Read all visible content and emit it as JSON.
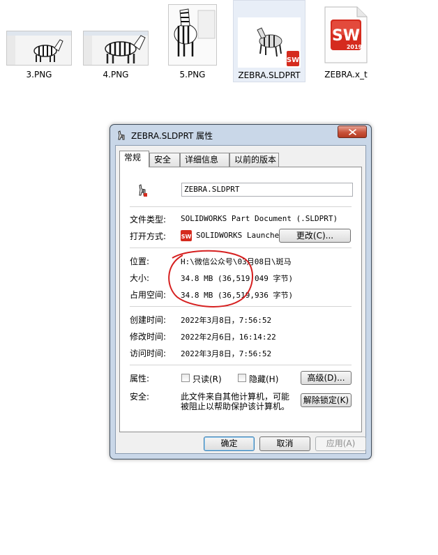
{
  "files": [
    {
      "name": "3.PNG",
      "icon": "zebra-screenshot-thumbnail"
    },
    {
      "name": "4.PNG",
      "icon": "zebra-screenshot-thumbnail"
    },
    {
      "name": "5.PNG",
      "icon": "zebra-screenshot-thumbnail"
    },
    {
      "name": "ZEBRA.SLDPRT",
      "icon": "zebra-part-thumbnail",
      "badge": "SW"
    },
    {
      "name": "ZEBRA.x_t",
      "icon": "solidworks-file-icon",
      "badge": "SW",
      "year": "2019"
    }
  ],
  "dialog": {
    "title": "ZEBRA.SLDPRT 属性",
    "tabs": [
      "常规",
      "安全",
      "详细信息",
      "以前的版本"
    ],
    "active_tab": "常规",
    "filename": "ZEBRA.SLDPRT",
    "file_type_label": "文件类型:",
    "file_type_value": "SOLIDWORKS Part Document (.SLDPRT)",
    "opens_with_label": "打开方式:",
    "opens_with_value": "SOLIDWORKS Launcher",
    "change_button": "更改(C)...",
    "location_label": "位置:",
    "location_value": "H:\\微信公众号\\03月08日\\斑马",
    "size_label": "大小:",
    "size_value": "34.8 MB (36,519,049 字节)",
    "size_on_disk_label": "占用空间:",
    "size_on_disk_value": "34.8 MB (36,519,936 字节)",
    "created_label": "创建时间:",
    "created_value": "2022年3月8日，7:56:52",
    "modified_label": "修改时间:",
    "modified_value": "2022年2月6日，16:14:22",
    "accessed_label": "访问时间:",
    "accessed_value": "2022年3月8日，7:56:52",
    "attributes_label": "属性:",
    "readonly_label": "只读(R)",
    "hidden_label": "隐藏(H)",
    "advanced_button": "高级(D)...",
    "security_label": "安全:",
    "security_text_line1": "此文件来自其他计算机，可能",
    "security_text_line2": "被阻止以帮助保护该计算机。",
    "unblock_button": "解除锁定(K)",
    "ok_button": "确定",
    "cancel_button": "取消",
    "apply_button": "应用(A)"
  },
  "colors": {
    "solidworks_red": "#d52b1e",
    "annotation_red": "#d62020",
    "selection_bg": "#e8eef7"
  }
}
